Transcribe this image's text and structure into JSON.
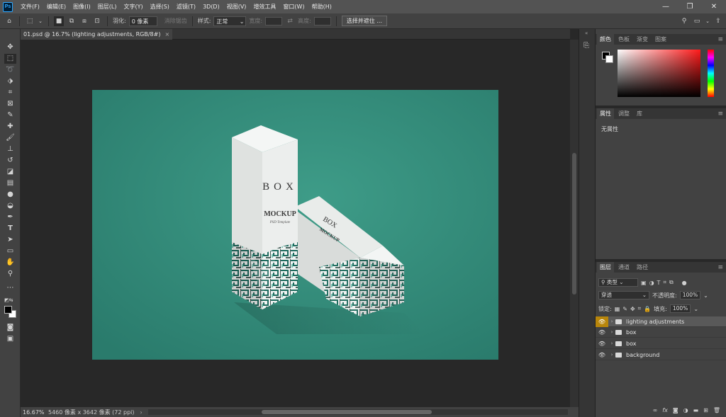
{
  "app": {
    "logo": "Ps"
  },
  "menu": [
    "文件(F)",
    "编辑(E)",
    "图像(I)",
    "图层(L)",
    "文字(Y)",
    "选择(S)",
    "滤镜(T)",
    "3D(D)",
    "视图(V)",
    "增效工具",
    "窗口(W)",
    "帮助(H)"
  ],
  "options": {
    "feather_label": "羽化:",
    "feather_value": "0 像素",
    "antialias_label": "消除锯齿",
    "style_label": "样式:",
    "style_value": "正常",
    "width_label": "宽度:",
    "height_label": "高度:",
    "select_mask_button": "选择并遮住 ..."
  },
  "document": {
    "tab_title": "01.psd @ 16.7% (lighting adjustments, RGB/8#)",
    "close_glyph": "×"
  },
  "status": {
    "zoom": "16.67%",
    "doc_info": "5460 像素 x 3642 像素 (72 ppi)",
    "arrow": "›"
  },
  "mockup": {
    "box_text": "BOX",
    "mockup_text": "MOCKUP",
    "subtitle": "PSD Template"
  },
  "panels": {
    "color_tabs": [
      "颜色",
      "色板",
      "渐变",
      "图案"
    ],
    "properties_tabs": [
      "属性",
      "调整",
      "库"
    ],
    "no_properties": "无属性",
    "layers_tabs": [
      "图层",
      "通道",
      "路径"
    ],
    "kind_label": "类型",
    "blend_mode": "穿透",
    "opacity_label": "不透明度:",
    "opacity_value": "100%",
    "lock_label": "锁定:",
    "fill_label": "填充:",
    "fill_value": "100%"
  },
  "layers": [
    {
      "name": "lighting adjustments",
      "selected": true
    },
    {
      "name": "box",
      "selected": false
    },
    {
      "name": "box",
      "selected": false
    },
    {
      "name": "background",
      "selected": false
    }
  ],
  "colors": {
    "canvas_bg": "#3c9683",
    "accent": "#b8860b",
    "panel": "#424242",
    "menubar": "#535353"
  }
}
